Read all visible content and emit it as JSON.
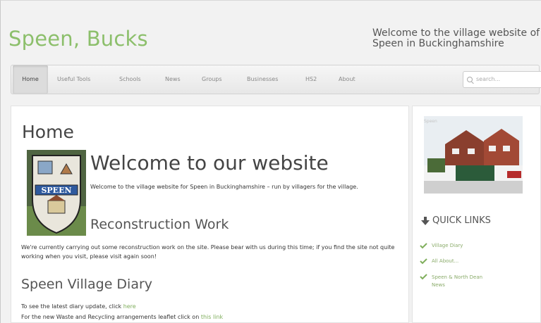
{
  "header": {
    "site_title": "Speen, Bucks",
    "tagline": "Welcome to the village website of Speen in Buckinghamshire"
  },
  "nav": {
    "items": [
      {
        "label": "Home",
        "active": true
      },
      {
        "label": "Useful Tools",
        "active": false
      },
      {
        "label": "Schools",
        "active": false
      },
      {
        "label": "News",
        "active": false
      },
      {
        "label": "Groups",
        "active": false
      },
      {
        "label": "Businesses",
        "active": false
      },
      {
        "label": "HS2",
        "active": false
      },
      {
        "label": "About",
        "active": false
      }
    ],
    "search_placeholder": "search..."
  },
  "main": {
    "page_heading": "Home",
    "welcome_heading": "Welcome to our website",
    "welcome_text": "Welcome to the village website for Speen in Buckinghamshire – run by villagers for the village.",
    "shield_text": "SPEEN",
    "reconstruction_heading": "Reconstruction Work",
    "reconstruction_text": "We're currently carrying out some reconstruction work on the site. Please bear with us during this time;  if you find the site not quite working when you visit, please visit again soon!",
    "diary_heading": "Speen Village Diary",
    "diary_line1_prefix": "To see the latest diary update, click ",
    "diary_line1_link": "here",
    "diary_line2_prefix": "For the new Waste and Recycling arrangements leaflet click on ",
    "diary_line2_link": "this link"
  },
  "sidebar": {
    "photo_caption": "Speen",
    "quick_links_heading": "QUICK LINKS",
    "quick_links": [
      "Village Diary",
      "All About...",
      "Speen & North Dean News"
    ]
  },
  "colors": {
    "accent_green": "#8cbf6b",
    "link_green": "#7fae5c"
  }
}
